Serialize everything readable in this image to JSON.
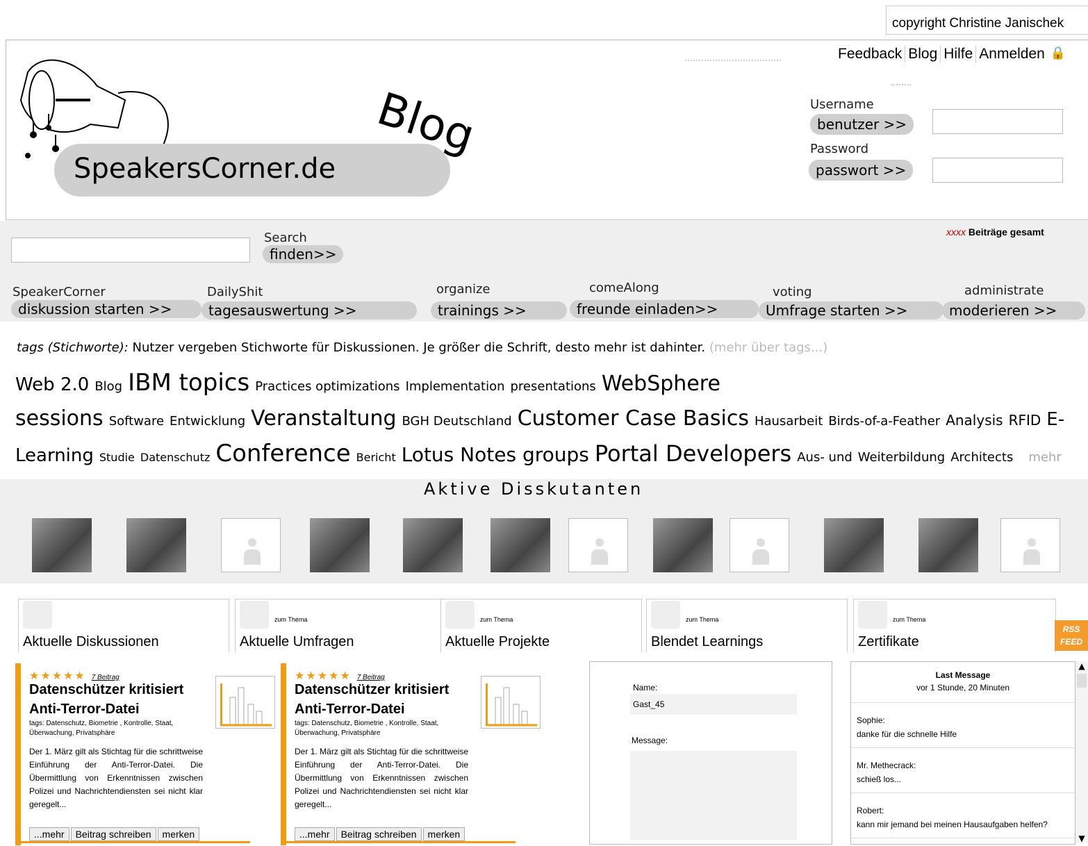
{
  "copyright": "copyright Christine Janischek",
  "logo": {
    "text": "SpeakersCorner.de",
    "blog": "Blog"
  },
  "topnav": [
    "Feedback",
    "Blog",
    "Hilfe",
    "Anmelden"
  ],
  "login": {
    "username_label": "Username",
    "username_button": "benutzer >>",
    "password_label": "Password",
    "password_button": "passwort >>"
  },
  "search": {
    "label": "Search",
    "button": "finden>>",
    "total_marker": "xxxx",
    "total_text": "Beiträge gesamt"
  },
  "actions": [
    {
      "caption": "SpeakerCorner",
      "button": "diskussion starten >>"
    },
    {
      "caption": "DailyShit",
      "button": "tagesauswertung >>"
    },
    {
      "caption": "organize",
      "button": "trainings >>"
    },
    {
      "caption": "comeAlong",
      "button": "freunde einladen>>"
    },
    {
      "caption": "voting",
      "button": "Umfrage starten >>"
    },
    {
      "caption": "administrate",
      "button": "moderieren >>"
    }
  ],
  "tags": {
    "label": "tags (Stichworte):",
    "description": "Nutzer vergeben Stichworte für Diskussionen. Je größer die Schrift, desto mehr ist dahinter.",
    "more_about": "(mehr über tags...)",
    "cloud": [
      {
        "t": "Web 2.0",
        "s": 26
      },
      {
        "t": "Blog",
        "s": 18
      },
      {
        "t": "IBM topics",
        "s": 34
      },
      {
        "t": "Practices optimizations",
        "s": 18
      },
      {
        "t": "Implementation",
        "s": 18
      },
      {
        "t": "presentations",
        "s": 18
      },
      {
        "t": "WebSphere sessions",
        "s": 30
      },
      {
        "t": "Software",
        "s": 18
      },
      {
        "t": "Entwicklung",
        "s": 18
      },
      {
        "t": "Veranstaltung",
        "s": 30
      },
      {
        "t": "BGH Deutschland",
        "s": 18
      },
      {
        "t": "Customer Case Basics",
        "s": 30
      },
      {
        "t": "Hausarbeit",
        "s": 18
      },
      {
        "t": "Birds-of-a-Feather",
        "s": 18
      },
      {
        "t": "Analysis",
        "s": 20
      },
      {
        "t": "RFID",
        "s": 20
      },
      {
        "t": "E-Learning",
        "s": 26
      },
      {
        "t": "Studie",
        "s": 16
      },
      {
        "t": "Datenschutz",
        "s": 16
      },
      {
        "t": "Conference",
        "s": 34
      },
      {
        "t": "Bericht",
        "s": 16
      },
      {
        "t": "Lotus Notes groups",
        "s": 28
      },
      {
        "t": "Portal Developers",
        "s": 32
      },
      {
        "t": "Aus- und",
        "s": 18
      },
      {
        "t": "Weiterbildung",
        "s": 18
      },
      {
        "t": "Architects",
        "s": 18
      }
    ],
    "more_tags": "mehr tags..."
  },
  "active_title": "Aktive Disskutanten",
  "avatars": [
    "photo",
    "photo",
    "blank",
    "photo",
    "photo",
    "photo",
    "blank",
    "photo",
    "blank",
    "photo",
    "photo",
    "blank"
  ],
  "tabs": [
    {
      "zum": "",
      "title": "Aktuelle Diskussionen"
    },
    {
      "zum": "zum Thema",
      "title": "Aktuelle Umfragen"
    },
    {
      "zum": "zum Thema",
      "title": "Aktuelle Projekte"
    },
    {
      "zum": "zum Thema",
      "title": "Blendet Learnings"
    },
    {
      "zum": "zum Thema",
      "title": "Zertifikate"
    }
  ],
  "rss_feed": {
    "line1": "RSS",
    "line2": "FEED"
  },
  "cards": [
    {
      "stars": "★★★★★",
      "count": "7 Beitrag",
      "headline": "Datenschützer kritisiert Anti-Terror-Datei",
      "tags": "tags: Datenschutz, Biometrie , Kontrolle, Staat, Überwachung, Privatsphäre",
      "body": "Der 1. März gilt als Stichtag für die schrittweise Einführung der Anti-Terror-Datei. Die Übermittlung von Erkenntnissen zwischen Polizei und Nachrichtendiensten sei nicht klar geregelt...",
      "buttons": [
        "...mehr",
        "Beitrag schreiben",
        "merken"
      ]
    },
    {
      "stars": "★★★★★",
      "count": "7 Beitrag",
      "headline": "Datenschützer kritisiert Anti-Terror-Datei",
      "tags": "tags: Datenschutz, Biometrie , Kontrolle, Staat, Überwachung, Privatsphäre",
      "body": "Der 1. März gilt als Stichtag für die schrittweise Einführung der Anti-Terror-Datei. Die Übermittlung von Erkenntnissen zwischen Polizei und Nachrichtendiensten sei nicht klar geregelt...",
      "buttons": [
        "...mehr",
        "Beitrag schreiben",
        "merken"
      ]
    }
  ],
  "form": {
    "name_label": "Name:",
    "name_value": "Gast_45",
    "message_label": "Message:"
  },
  "chat": {
    "title": "Last Message",
    "time": "vor 1 Stunde, 20 Minuten",
    "messages": [
      {
        "user": "Sophie:",
        "text": "danke für die schnelle Hilfe"
      },
      {
        "user": "Mr. Methecrack:",
        "text": "schieß los..."
      },
      {
        "user": "Robert:",
        "text": "kann mir jemand bei meinen Hausaufgaben helfen?"
      }
    ]
  }
}
